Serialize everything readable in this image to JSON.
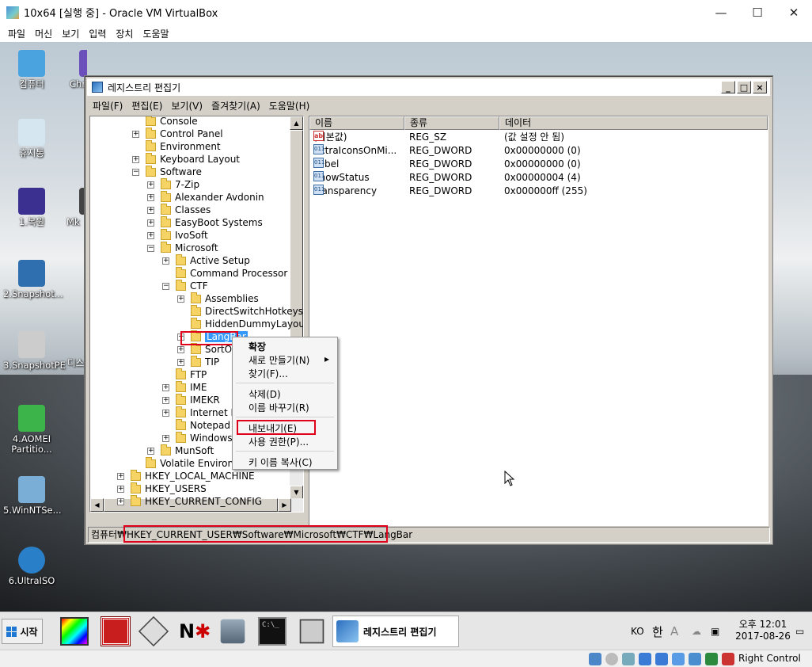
{
  "vbox": {
    "title": "10x64 [실행 중] - Oracle VM VirtualBox",
    "menu": [
      "파일",
      "머신",
      "보기",
      "입력",
      "장치",
      "도움말"
    ],
    "status_right": "Right Control"
  },
  "desktop": {
    "icons": [
      {
        "label": "컴퓨터",
        "icon": "computer-icon",
        "color": "#4aa3df"
      },
      {
        "label": "Chr",
        "icon": "chrome-icon",
        "color": "#6b4fbb"
      },
      {
        "label": "휴지통",
        "icon": "recycle-bin-icon",
        "color": "#d6e6f0"
      },
      {
        "label": "1.복원",
        "icon": "br-icon",
        "color": "#3b2f8f"
      },
      {
        "label": "Mk",
        "icon": "mk-icon",
        "color": "#444"
      },
      {
        "label": "2.Snapshot...",
        "icon": "br-icon",
        "color": "#2f6fb0"
      },
      {
        "label": "3.SnapshotPE",
        "icon": "snapshot-icon",
        "color": "#ccc"
      },
      {
        "label": "디스",
        "icon": "disk-icon",
        "color": "#888"
      },
      {
        "label": "4.AOMEI Partitio...",
        "icon": "aomei-icon",
        "color": "#3cb44a"
      },
      {
        "label": "5.WinNTSe...",
        "icon": "winntsetup-icon",
        "color": "#7aaed6"
      },
      {
        "label": "6.UltraISO",
        "icon": "ultraiso-icon",
        "color": "#2a7fc9"
      }
    ]
  },
  "regedit": {
    "title": "레지스트리 편집기",
    "window_buttons": [
      "_",
      "□",
      "×"
    ],
    "menu": [
      "파일(F)",
      "편집(E)",
      "보기(V)",
      "즐겨찾기(A)",
      "도움말(H)"
    ],
    "tree": [
      {
        "label": "Console",
        "level": 3,
        "expander": ""
      },
      {
        "label": "Control Panel",
        "level": 3,
        "expander": "+"
      },
      {
        "label": "Environment",
        "level": 3,
        "expander": ""
      },
      {
        "label": "Keyboard Layout",
        "level": 3,
        "expander": "+"
      },
      {
        "label": "Software",
        "level": 3,
        "expander": "-"
      },
      {
        "label": "7-Zip",
        "level": 4,
        "expander": "+"
      },
      {
        "label": "Alexander Avdonin",
        "level": 4,
        "expander": "+"
      },
      {
        "label": "Classes",
        "level": 4,
        "expander": "+"
      },
      {
        "label": "EasyBoot Systems",
        "level": 4,
        "expander": "+"
      },
      {
        "label": "IvoSoft",
        "level": 4,
        "expander": "+"
      },
      {
        "label": "Microsoft",
        "level": 4,
        "expander": "-"
      },
      {
        "label": "Active Setup",
        "level": 5,
        "expander": "+"
      },
      {
        "label": "Command Processor",
        "level": 5,
        "expander": ""
      },
      {
        "label": "CTF",
        "level": 5,
        "expander": "-"
      },
      {
        "label": "Assemblies",
        "level": 6,
        "expander": "+"
      },
      {
        "label": "DirectSwitchHotkeys",
        "level": 6,
        "expander": ""
      },
      {
        "label": "HiddenDummyLayou",
        "level": 6,
        "expander": ""
      },
      {
        "label": "LangBar",
        "level": 6,
        "expander": "+",
        "selected": true
      },
      {
        "label": "SortOrd",
        "level": 6,
        "expander": "+"
      },
      {
        "label": "TIP",
        "level": 6,
        "expander": "+"
      },
      {
        "label": "FTP",
        "level": 5,
        "expander": ""
      },
      {
        "label": "IME",
        "level": 5,
        "expander": "+"
      },
      {
        "label": "IMEKR",
        "level": 5,
        "expander": "+"
      },
      {
        "label": "Internet Ex",
        "level": 5,
        "expander": "+"
      },
      {
        "label": "Notepad",
        "level": 5,
        "expander": ""
      },
      {
        "label": "Windows",
        "level": 5,
        "expander": "+"
      },
      {
        "label": "MunSoft",
        "level": 4,
        "expander": "+"
      },
      {
        "label": "Volatile Environm",
        "level": 3,
        "expander": ""
      },
      {
        "label": "HKEY_LOCAL_MACHINE",
        "level": 2,
        "expander": "+"
      },
      {
        "label": "HKEY_USERS",
        "level": 2,
        "expander": "+"
      },
      {
        "label": "HKEY_CURRENT_CONFIG",
        "level": 2,
        "expander": "+"
      }
    ],
    "columns": [
      "이름",
      "종류",
      "데이터"
    ],
    "values": [
      {
        "name": "(기본값)",
        "type": "REG_SZ",
        "data": "(값 설정 안 됨)",
        "icon": "ab"
      },
      {
        "name": "ExtraIconsOnMi...",
        "type": "REG_DWORD",
        "data": "0x00000000 (0)",
        "icon": "bin"
      },
      {
        "name": "Label",
        "type": "REG_DWORD",
        "data": "0x00000000 (0)",
        "icon": "bin"
      },
      {
        "name": "ShowStatus",
        "type": "REG_DWORD",
        "data": "0x00000004 (4)",
        "icon": "bin"
      },
      {
        "name": "Transparency",
        "type": "REG_DWORD",
        "data": "0x000000ff (255)",
        "icon": "bin"
      }
    ],
    "status_prefix": "컴퓨터",
    "status_path": "₩HKEY_CURRENT_USER₩Software₩Microsoft₩CTF₩LangBar"
  },
  "context_menu": {
    "items": [
      {
        "label": "확장",
        "bold": true
      },
      {
        "label": "새로 만들기(N)",
        "submenu": "▸"
      },
      {
        "label": "찾기(F)..."
      },
      {
        "label": "삭제(D)"
      },
      {
        "label": "이름 바꾸기(R)"
      },
      {
        "label": "내보내기(E)",
        "highlight": true
      },
      {
        "label": "사용 권한(P)..."
      },
      {
        "label": "키 이름 복사(C)"
      }
    ]
  },
  "taskbar": {
    "start_label": "시작",
    "apps": [
      "colors-app-icon",
      "memtest-app-icon",
      "disk-app-icon",
      "nt-password-app-icon",
      "network-app-icon",
      "cmd-app-icon",
      "monitor-app-icon"
    ],
    "active_label": "레지스트리 편집기",
    "lang": "KO",
    "ime": "한",
    "ime2": "A",
    "time_line1": "오후 12:01",
    "time_line2": "2017-08-26"
  },
  "colors": {
    "accent": "#3399ff",
    "annotation_red": "#e0001b"
  }
}
